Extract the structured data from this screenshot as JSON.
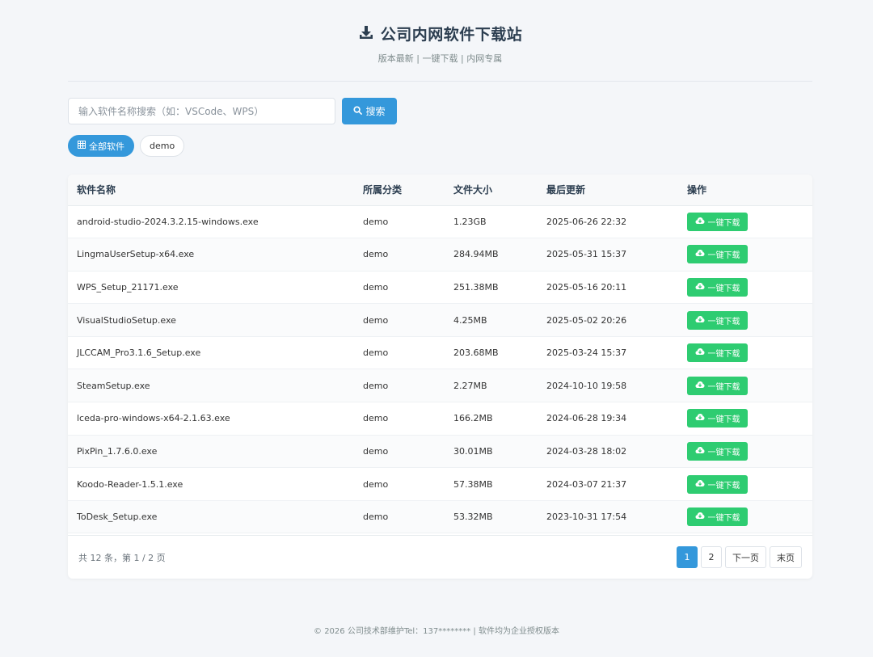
{
  "header": {
    "title": "公司内网软件下载站",
    "subtitle": "版本最新 | 一键下载 | 内网专属"
  },
  "search": {
    "placeholder": "输入软件名称搜索（如：VSCode、WPS）",
    "value": "",
    "button_label": "搜索"
  },
  "categories": {
    "all_label": "全部软件",
    "items": [
      "demo"
    ]
  },
  "table": {
    "columns": [
      "软件名称",
      "所属分类",
      "文件大小",
      "最后更新",
      "操作"
    ],
    "download_label": "一键下载",
    "rows": [
      {
        "name": "android-studio-2024.3.2.15-windows.exe",
        "category": "demo",
        "size": "1.23GB",
        "updated": "2025-06-26 22:32"
      },
      {
        "name": "LingmaUserSetup-x64.exe",
        "category": "demo",
        "size": "284.94MB",
        "updated": "2025-05-31 15:37"
      },
      {
        "name": "WPS_Setup_21171.exe",
        "category": "demo",
        "size": "251.38MB",
        "updated": "2025-05-16 20:11"
      },
      {
        "name": "VisualStudioSetup.exe",
        "category": "demo",
        "size": "4.25MB",
        "updated": "2025-05-02 20:26"
      },
      {
        "name": "JLCCAM_Pro3.1.6_Setup.exe",
        "category": "demo",
        "size": "203.68MB",
        "updated": "2025-03-24 15:37"
      },
      {
        "name": "SteamSetup.exe",
        "category": "demo",
        "size": "2.27MB",
        "updated": "2024-10-10 19:58"
      },
      {
        "name": "lceda-pro-windows-x64-2.1.63.exe",
        "category": "demo",
        "size": "166.2MB",
        "updated": "2024-06-28 19:34"
      },
      {
        "name": "PixPin_1.7.6.0.exe",
        "category": "demo",
        "size": "30.01MB",
        "updated": "2024-03-28 18:02"
      },
      {
        "name": "Koodo-Reader-1.5.1.exe",
        "category": "demo",
        "size": "57.38MB",
        "updated": "2024-03-07 21:37"
      },
      {
        "name": "ToDesk_Setup.exe",
        "category": "demo",
        "size": "53.32MB",
        "updated": "2023-10-31 17:54"
      }
    ]
  },
  "pagination": {
    "info": "共 12 条，第 1 / 2 页",
    "pages": [
      "1",
      "2"
    ],
    "current": "1",
    "next_label": "下一页",
    "last_label": "末页"
  },
  "footer": {
    "text": "© 2026 公司技术部维护Tel：137******** | 软件均为企业授权版本"
  },
  "colors": {
    "primary": "#3498db",
    "download": "#2ecc71",
    "background": "#f4f6f9"
  },
  "icons": {
    "title": "download-icon",
    "search": "search-icon",
    "all_categories": "grid-icon",
    "download_button": "cloud-download-icon"
  }
}
